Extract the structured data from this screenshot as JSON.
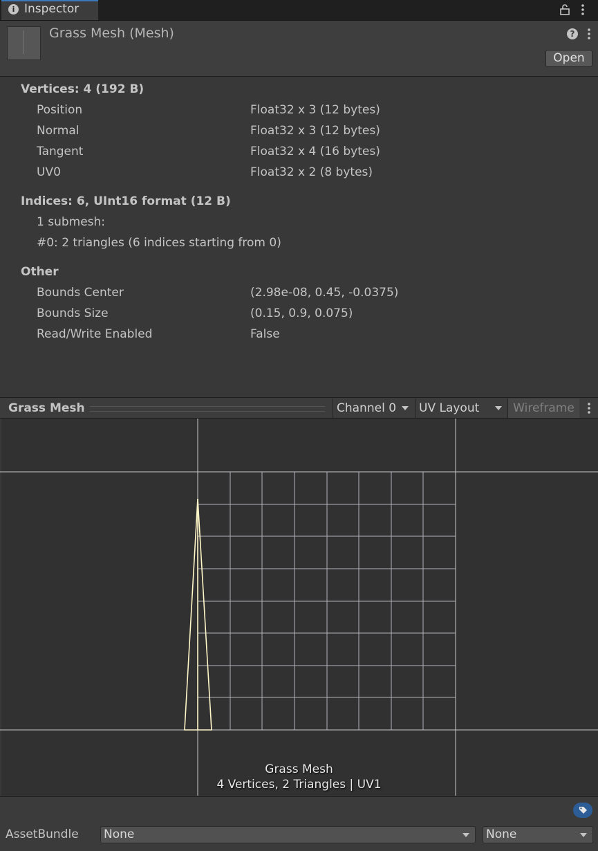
{
  "tab": {
    "label": "Inspector",
    "info_icon": "i"
  },
  "header": {
    "title": "Grass Mesh (Mesh)",
    "help_icon": "?",
    "open_label": "Open"
  },
  "vertices": {
    "title": "Vertices: 4 (192 B)",
    "rows": [
      {
        "label": "Position",
        "value": "Float32 x 3 (12 bytes)"
      },
      {
        "label": "Normal",
        "value": "Float32 x 3 (12 bytes)"
      },
      {
        "label": "Tangent",
        "value": "Float32 x 4 (16 bytes)"
      },
      {
        "label": "UV0",
        "value": "Float32 x 2 (8 bytes)"
      }
    ]
  },
  "indices": {
    "title": "Indices: 6, UInt16 format (12 B)",
    "submesh_count": "1 submesh:",
    "submesh_0": "#0: 2 triangles (6 indices starting from 0)"
  },
  "other": {
    "title": "Other",
    "rows": [
      {
        "label": "Bounds Center",
        "value": "(2.98e-08, 0.45, -0.0375)"
      },
      {
        "label": "Bounds Size",
        "value": "(0.15, 0.9, 0.075)"
      },
      {
        "label": "Read/Write Enabled",
        "value": "False"
      }
    ]
  },
  "preview": {
    "title": "Grass Mesh",
    "channel": "Channel 0",
    "layout": "UV Layout",
    "wireframe": "Wireframe",
    "caption_name": "Grass Mesh",
    "caption_stats": "4 Vertices, 2 Triangles | UV1"
  },
  "asset_bundle": {
    "label": "AssetBundle",
    "name_value": "None",
    "variant_value": "None"
  },
  "colors": {
    "accent": "#3a79bb",
    "wire": "#fff7c8",
    "grid": "#c8c8d2"
  }
}
